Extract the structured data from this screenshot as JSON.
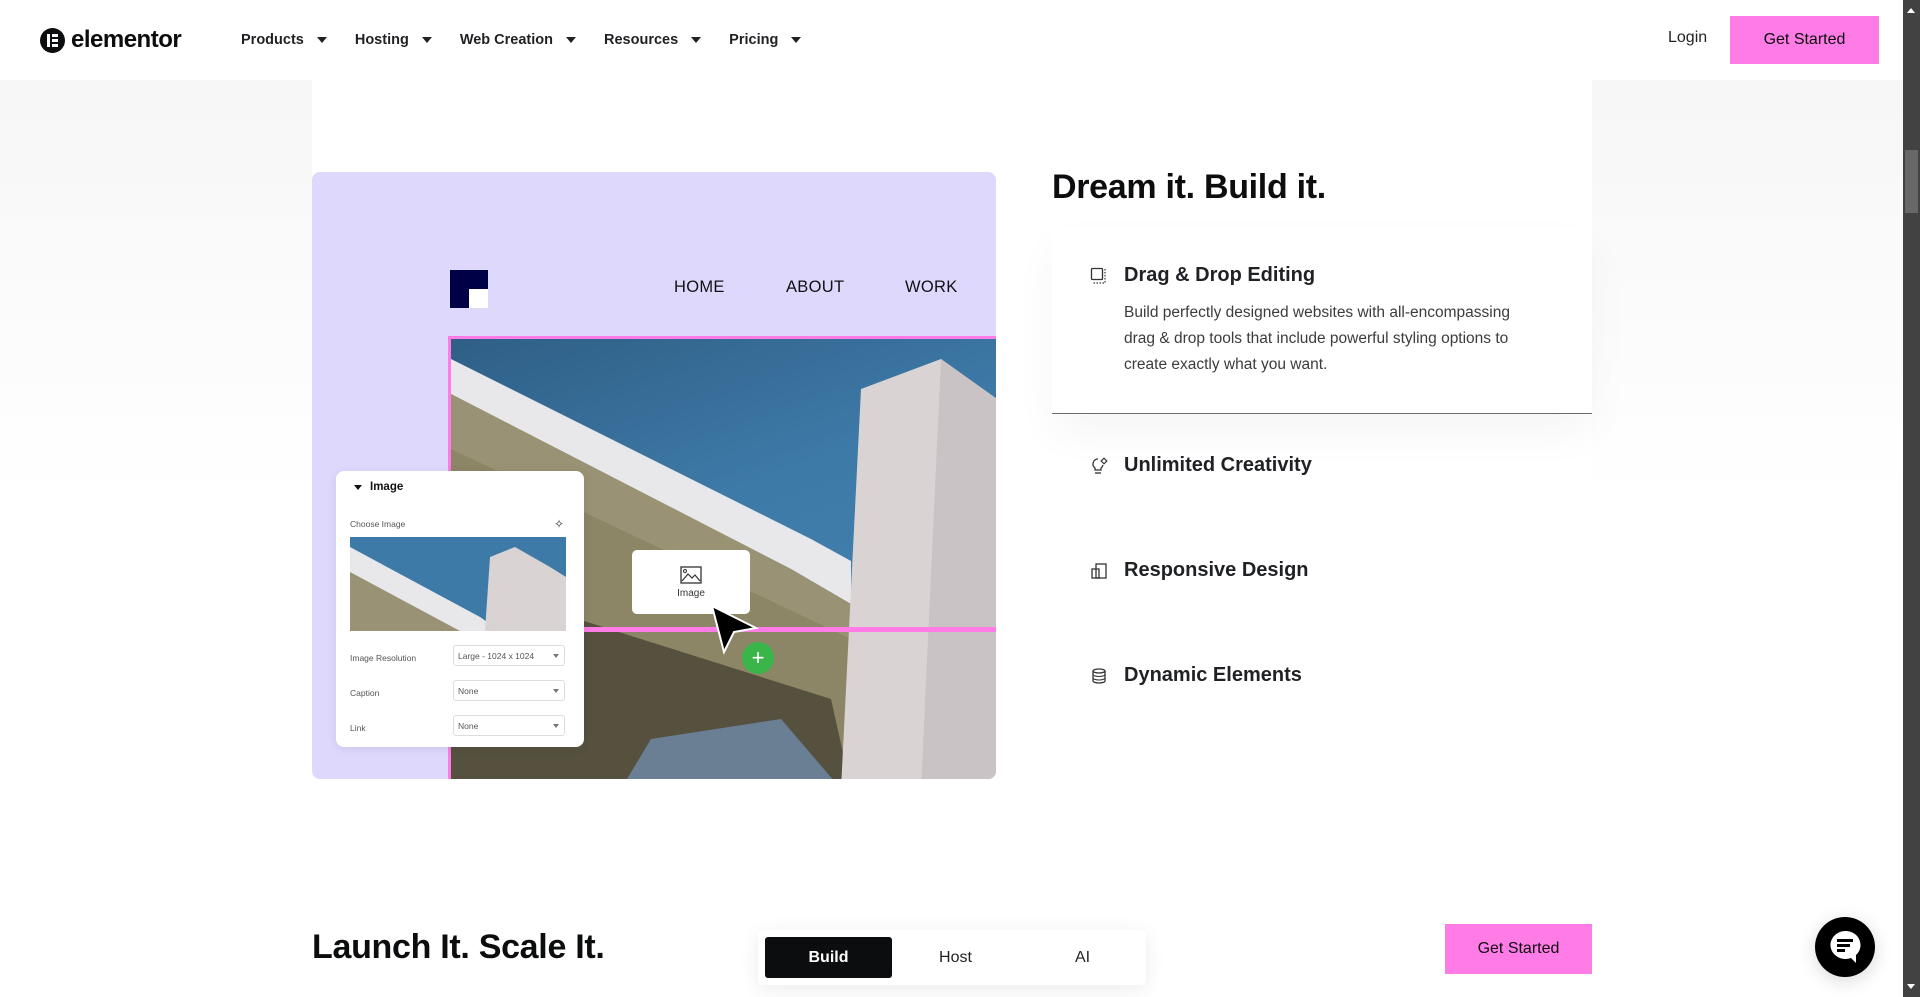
{
  "header": {
    "logo_text": "elementor",
    "nav": [
      {
        "label": "Products"
      },
      {
        "label": "Hosting"
      },
      {
        "label": "Web Creation"
      },
      {
        "label": "Resources"
      },
      {
        "label": "Pricing"
      }
    ],
    "login_label": "Login",
    "cta_label": "Get Started"
  },
  "showcase": {
    "mock_nav": [
      "HOME",
      "ABOUT",
      "WORK"
    ],
    "panel": {
      "title": "Image",
      "choose_image_label": "Choose Image",
      "fields": [
        {
          "label": "Image Resolution",
          "value": "Large - 1024 x 1024"
        },
        {
          "label": "Caption",
          "value": "None"
        },
        {
          "label": "Link",
          "value": "None"
        }
      ]
    },
    "widget_label": "Image"
  },
  "features": {
    "title": "Dream it. Build it.",
    "items": [
      {
        "title": "Drag & Drop Editing",
        "icon": "drag-drop-icon",
        "active": true,
        "description": "Build perfectly designed websites with all-encompassing drag & drop tools that include powerful styling options to create exactly what you want."
      },
      {
        "title": "Unlimited Creativity",
        "icon": "lightbulb-icon",
        "active": false
      },
      {
        "title": "Responsive Design",
        "icon": "responsive-icon",
        "active": false
      },
      {
        "title": "Dynamic Elements",
        "icon": "database-icon",
        "active": false
      }
    ]
  },
  "bottom": {
    "title": "Launch It. Scale It.",
    "tabs": [
      {
        "label": "Build",
        "active": true
      },
      {
        "label": "Host",
        "active": false
      },
      {
        "label": "AI",
        "active": false
      }
    ],
    "cta_label": "Get Started"
  },
  "colors": {
    "accent_pink": "#ff7be5",
    "showcase_purple": "#dfd8fd",
    "plus_green": "#39b54a",
    "text_dark": "#0c0d0e"
  }
}
